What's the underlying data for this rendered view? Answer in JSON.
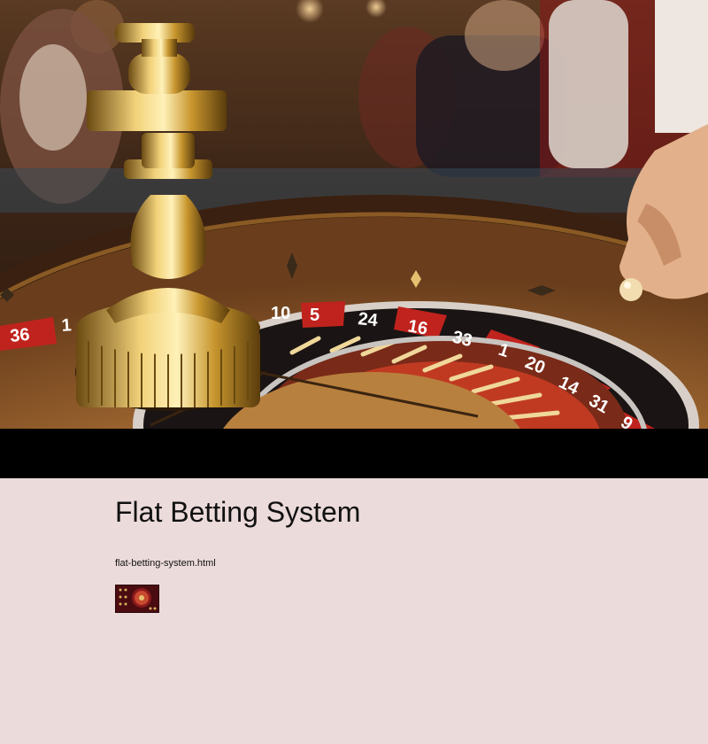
{
  "hero": {
    "image": "roulette-wheel-photo",
    "wheel_numbers": [
      "36",
      "1",
      "10",
      "5",
      "24",
      "16",
      "33",
      "1",
      "20",
      "14",
      "31",
      "9"
    ]
  },
  "page": {
    "title": "Flat Betting System",
    "link_text": "flat-betting-system.html",
    "thumbnail": "roulette-thumbnail-icon"
  },
  "colors": {
    "background": "#ecdbdb",
    "hero_bar": "#000000",
    "text": "#111111",
    "wheel_red": "#c0231d",
    "wheel_black": "#1a1414",
    "gold": "#c8962e"
  }
}
